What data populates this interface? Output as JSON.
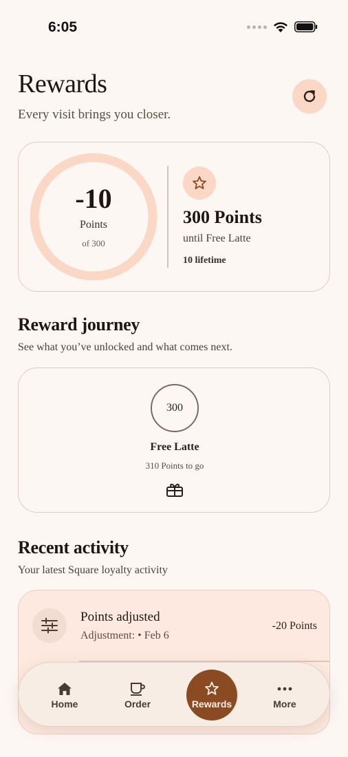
{
  "status_bar": {
    "time": "6:05"
  },
  "header": {
    "title": "Rewards",
    "subtitle": "Every visit brings you closer."
  },
  "points_card": {
    "balance": "-10",
    "balance_label": "Points",
    "goal_text": "of 300",
    "progress_fraction": 0,
    "next_points": "300 Points",
    "next_reward": "until Free Latte",
    "lifetime": "10 lifetime"
  },
  "journey": {
    "title": "Reward journey",
    "subtitle": "See what you’ve unlocked and what comes next.",
    "milestones": [
      {
        "points": "300",
        "name": "Free Latte",
        "remaining": "310 Points to go"
      }
    ]
  },
  "activity": {
    "title": "Recent activity",
    "subtitle": "Your latest Square loyalty activity",
    "items": [
      {
        "title": "Points adjusted",
        "detail": "Adjustment: • Feb 6",
        "points": "-20 Points"
      }
    ]
  },
  "nav": {
    "items": [
      {
        "label": "Home",
        "icon": "home-icon"
      },
      {
        "label": "Order",
        "icon": "cup-icon"
      },
      {
        "label": "Rewards",
        "icon": "star-icon",
        "active": true
      },
      {
        "label": "More",
        "icon": "more-icon"
      }
    ]
  },
  "colors": {
    "background": "#fdf7f3",
    "accent": "#8a4a22",
    "accent_soft": "#fbd8c5",
    "activity_bg": "#fde9df"
  }
}
